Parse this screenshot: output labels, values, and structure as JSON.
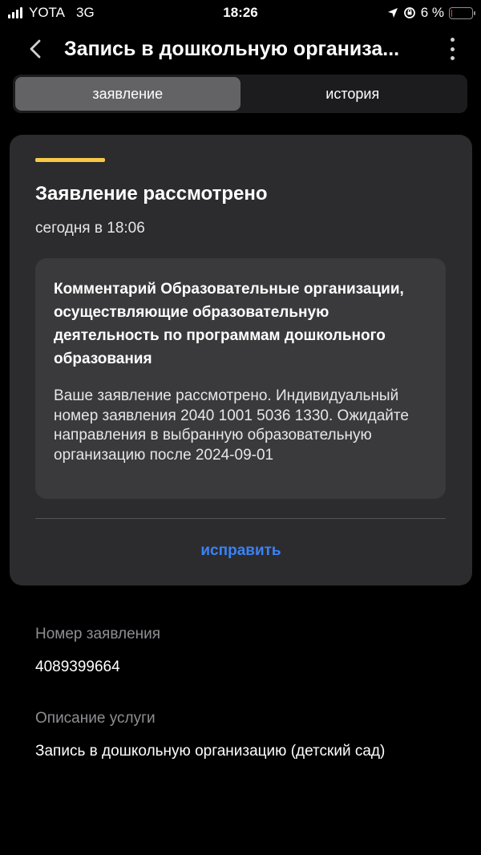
{
  "status_bar": {
    "carrier": "YOTA",
    "network": "3G",
    "time": "18:26",
    "battery": "6 %",
    "battery_level": 0.06,
    "battery_color": "#ff3b30"
  },
  "header": {
    "title": "Запись в дошкольную организа...",
    "back_icon": "chevron-left-icon",
    "menu_icon": "more-vertical-icon"
  },
  "tabs": [
    {
      "label": "заявление",
      "active": true
    },
    {
      "label": "история",
      "active": false
    }
  ],
  "card": {
    "accent_color": "#f7c948",
    "status_title": "Заявление рассмотрено",
    "status_time": "сегодня в 18:06",
    "comment": {
      "title": "Комментарий Образовательные организации, осуществляющие образовательную деятельность по программам дошкольного образования",
      "body": "Ваше заявление рассмотрено. Индивидуальный номер заявления 2040 1001 5036 1330. Ожидайте направления в выбранную образовательную организацию после 2024-09-01"
    },
    "action_label": "исправить",
    "action_color": "#3a82f7"
  },
  "details": {
    "number_label": "Номер заявления",
    "number_value": "4089399664",
    "service_label": "Описание услуги",
    "service_value": "Запись в дошкольную организацию (детский сад)"
  }
}
